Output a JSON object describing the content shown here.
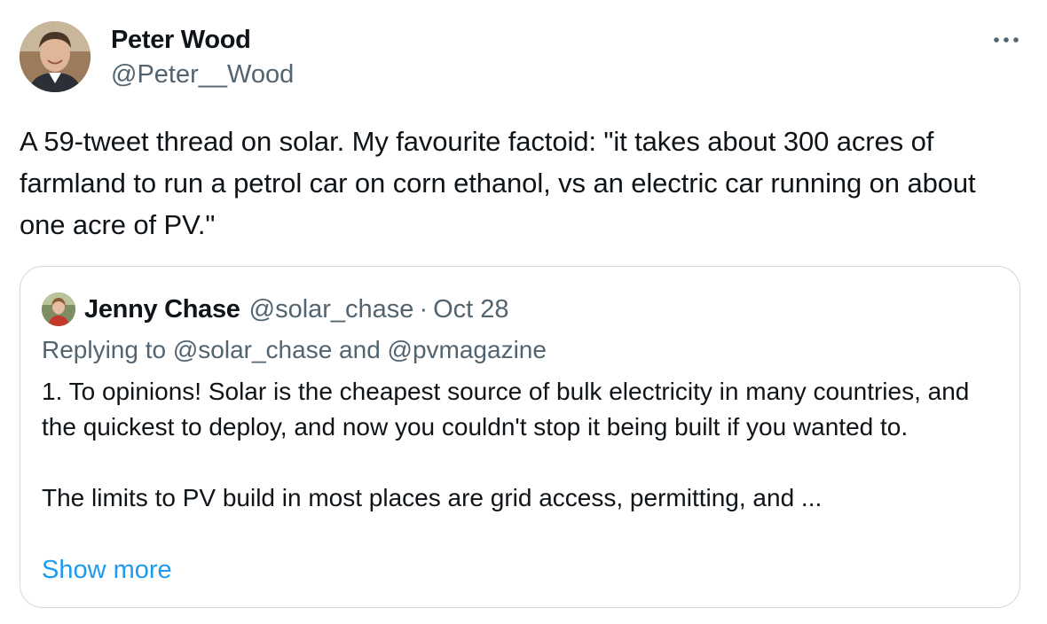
{
  "tweet": {
    "author": {
      "name": "Peter Wood",
      "handle": "@Peter__Wood"
    },
    "text": "A 59-tweet thread on solar. My favourite factoid: \"it takes about 300 acres of farmland to run a petrol car on corn ethanol, vs an electric car running on about one acre of PV.\"",
    "more_icon": "more-horizontal-icon"
  },
  "quote": {
    "author": {
      "name": "Jenny Chase",
      "handle": "@solar_chase"
    },
    "separator": "·",
    "date": "Oct 28",
    "replying_to": "Replying to @solar_chase and @pvmagazine",
    "paragraphs": [
      "1. To opinions! Solar is the cheapest source of bulk electricity in many countries, and the quickest to deploy, and now you couldn't stop it being built if you wanted to.",
      "The limits to PV build in most places are grid access, permitting, and ..."
    ],
    "show_more": "Show more"
  },
  "colors": {
    "text": "#0f1419",
    "secondary": "#536471",
    "link": "#1d9bf0",
    "border": "#cfd9de"
  }
}
